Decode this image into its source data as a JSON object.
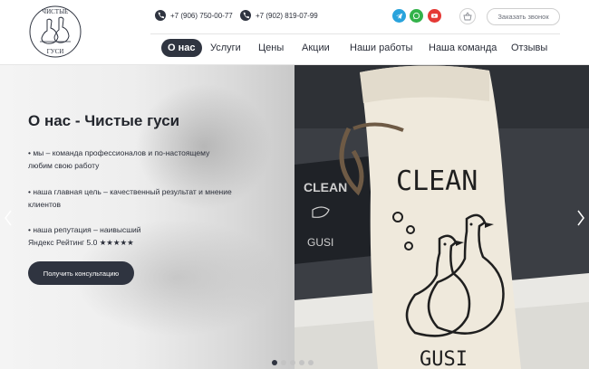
{
  "brand": {
    "name_line1": "ЧИСТЫЕ",
    "name_line2": "ГУСИ"
  },
  "header": {
    "phones": [
      "+7 (906) 750-00-77",
      "+7 (902) 819-07-99"
    ],
    "social": [
      {
        "icon": "telegram-icon",
        "color": "#29a3dc"
      },
      {
        "icon": "whatsapp-icon",
        "color": "#33b24a"
      },
      {
        "icon": "youtube-icon",
        "color": "#e53935"
      }
    ],
    "cart_icon": "basket-icon",
    "call_button": "Заказать звонок"
  },
  "nav": {
    "items": [
      "О нас",
      "Услуги",
      "Цены",
      "Акции",
      "Наши работы",
      "Наша команда",
      "Отзывы"
    ],
    "active_index": 0
  },
  "hero": {
    "title": "О нас - Чистые гуси",
    "bullets": [
      [
        "• мы – команда профессионалов и по-настоящему",
        "любим свою работу"
      ],
      [
        "• наша главная цель – качественный результат и мнение",
        "клиентов"
      ],
      [
        "• наша репутация – наивысший",
        "Яндекс Рейтинг 5.0 ★★★★★"
      ]
    ],
    "cta": "Получить консультацию",
    "bag_text_top": "CLEAN",
    "bag_text_bottom": "GUSI",
    "bg_bag_text_top": "CLEAN",
    "bg_bag_text_bottom": "GUSI",
    "slides_total": 5,
    "active_slide": 1
  },
  "colors": {
    "dark": "#2f3440",
    "accent_text": "#23262d"
  }
}
